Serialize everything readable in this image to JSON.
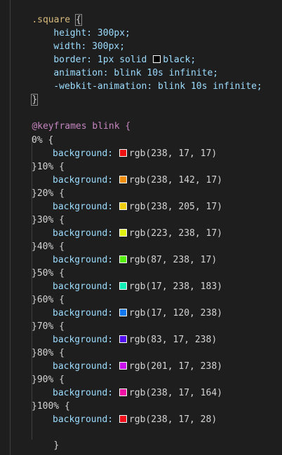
{
  "square_rule": {
    "selector": ".square",
    "open_brace": "{",
    "decls": [
      {
        "text": "height: 300px;"
      },
      {
        "text": "width: 300px;"
      },
      {
        "pre": "border: 1px solid ",
        "color": "#000000",
        "post": "black;"
      },
      {
        "text": "animation: blink 10s infinite;"
      },
      {
        "text": "-webkit-animation: blink 10s infinite;"
      }
    ],
    "close_brace": "}"
  },
  "keyframes": {
    "header": "@keyframes blink {",
    "first_selector": "0% {",
    "property": "background: ",
    "steps": [
      {
        "sel": "0% {",
        "color": "#ee1111",
        "value": "rgb(238, 17, 17)"
      },
      {
        "sel": "}10% {",
        "color": "#ee8e11",
        "value": "rgb(238, 142, 17)"
      },
      {
        "sel": "}20% {",
        "color": "#eecd11",
        "value": "rgb(238, 205, 17)"
      },
      {
        "sel": "}30% {",
        "color": "#dfee11",
        "value": "rgb(223, 238, 17)"
      },
      {
        "sel": "}40% {",
        "color": "#57ee11",
        "value": "rgb(87, 238, 17)"
      },
      {
        "sel": "}50% {",
        "color": "#11eeb7",
        "value": "rgb(17, 238, 183)"
      },
      {
        "sel": "}60% {",
        "color": "#1178ee",
        "value": "rgb(17, 120, 238)"
      },
      {
        "sel": "}70% {",
        "color": "#5311ee",
        "value": "rgb(83, 17, 238)"
      },
      {
        "sel": "}80% {",
        "color": "#c911ee",
        "value": "rgb(201, 17, 238)"
      },
      {
        "sel": "}90% {",
        "color": "#ee11a4",
        "value": "rgb(238, 17, 164)"
      },
      {
        "sel": "}100% {",
        "color": "#ee111c",
        "value": "rgb(238, 17, 28)"
      }
    ],
    "last_close": "}"
  }
}
